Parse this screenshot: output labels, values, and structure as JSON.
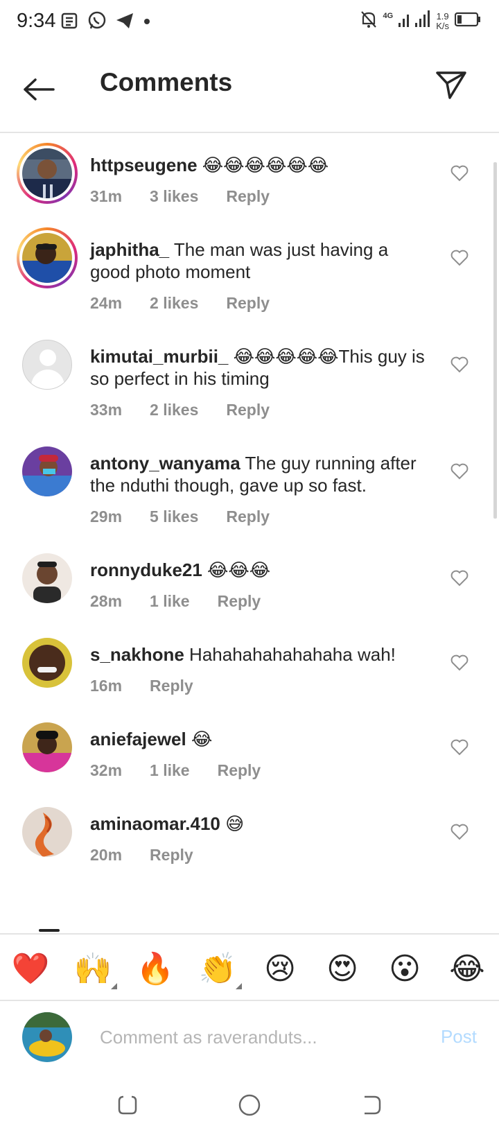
{
  "status_bar": {
    "time": "9:34",
    "network_gen": "4G",
    "net_speed_value": "1.9",
    "net_speed_unit": "K/s"
  },
  "header": {
    "title": "Comments"
  },
  "comments": [
    {
      "username": "httpseugene",
      "text": " 😂😂😂😂😂😂",
      "time": "31m",
      "likes": "3 likes",
      "reply": "Reply",
      "avatar": "footballer in Inter jersey"
    },
    {
      "username": "japhitha_",
      "text": " The man was just having a good photo moment",
      "time": "24m",
      "likes": "2 likes",
      "reply": "Reply",
      "avatar": "man in blue jersey"
    },
    {
      "username": "kimutai_murbii_",
      "text": " 😂😂😂😂😂This guy is so perfect in his timing",
      "time": "33m",
      "likes": "2 likes",
      "reply": "Reply",
      "avatar": "default-avatar"
    },
    {
      "username": "antony_wanyama",
      "text": " The guy running after the nduthi though, gave up so fast.",
      "time": "29m",
      "likes": "5 likes",
      "reply": "Reply",
      "avatar": "man with cap and mask"
    },
    {
      "username": "ronnyduke21",
      "text": " 😂😂😂",
      "time": "28m",
      "likes": "1 like",
      "reply": "Reply",
      "avatar": "young man portrait"
    },
    {
      "username": "s_nakhone",
      "text": " Hahahahahahahaha wah!",
      "time": "16m",
      "likes": "",
      "reply": "Reply",
      "avatar": "smiling man"
    },
    {
      "username": "aniefajewel",
      "text": " 😂",
      "time": "32m",
      "likes": "1 like",
      "reply": "Reply",
      "avatar": "woman portrait pink"
    },
    {
      "username": "aminaomar.410",
      "text": " 😅",
      "time": "20m",
      "likes": "",
      "reply": "Reply",
      "avatar": "orange artwork"
    }
  ],
  "emoji_bar": [
    "❤️",
    "🙌",
    "🔥",
    "👏",
    "😢",
    "😍",
    "😮",
    "😂"
  ],
  "composer": {
    "placeholder": "Comment as raveranduts...",
    "post_label": "Post"
  },
  "colors": {
    "accent_disabled": "#b3dbff",
    "meta_gray": "#8e8e8e",
    "text": "#262626"
  }
}
